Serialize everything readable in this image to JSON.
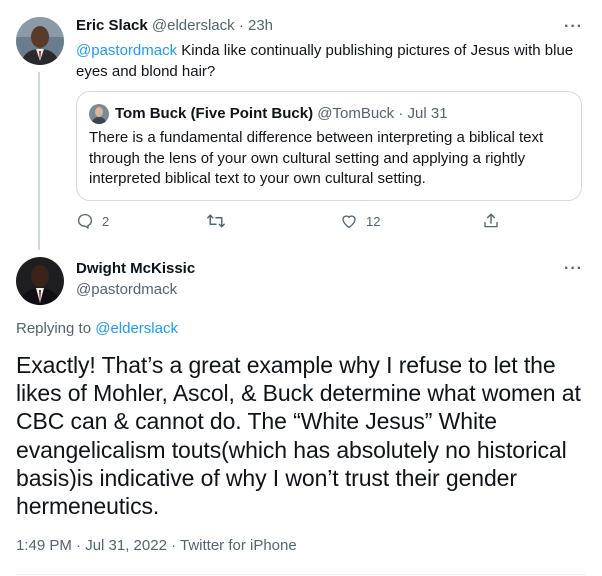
{
  "tweet1": {
    "name": "Eric Slack",
    "handle": "@elderslack",
    "separator": "·",
    "time": "23h",
    "mention": "@pastordmack",
    "text": " Kinda like continually publishing pictures of Jesus with blue eyes and blond hair?"
  },
  "quote": {
    "name": "Tom Buck (Five Point Buck)",
    "handle": "@TomBuck",
    "separator": "·",
    "date": "Jul 31",
    "text": "There is a fundamental difference between interpreting a biblical text through the lens of your own cultural setting and applying a rightly interpreted biblical text to your own cultural setting."
  },
  "actions": {
    "reply_count": "2",
    "retweet_count": "",
    "like_count": "12"
  },
  "tweet2": {
    "name": "Dwight McKissic",
    "handle": "@pastordmack",
    "replying_prefix": "Replying to ",
    "replying_to": "@elderslack",
    "text": "Exactly! That’s a great example why I refuse to let the likes of Mohler, Ascol, & Buck determine what women at CBC can & cannot do. The “White Jesus” White evangelicalism touts(which has absolutely no historical basis)is indicative of why I won’t trust their gender hermeneutics.",
    "timestamp": "1:49 PM · Jul 31, 2022 · Twitter for iPhone"
  },
  "icons": {
    "more": "more-icon",
    "reply": "reply-icon",
    "retweet": "retweet-icon",
    "like": "heart-icon",
    "share": "share-icon"
  },
  "colors": {
    "link": "#1d9bf0",
    "muted": "#536471",
    "border": "#cfd9de",
    "text": "#0f1419"
  }
}
